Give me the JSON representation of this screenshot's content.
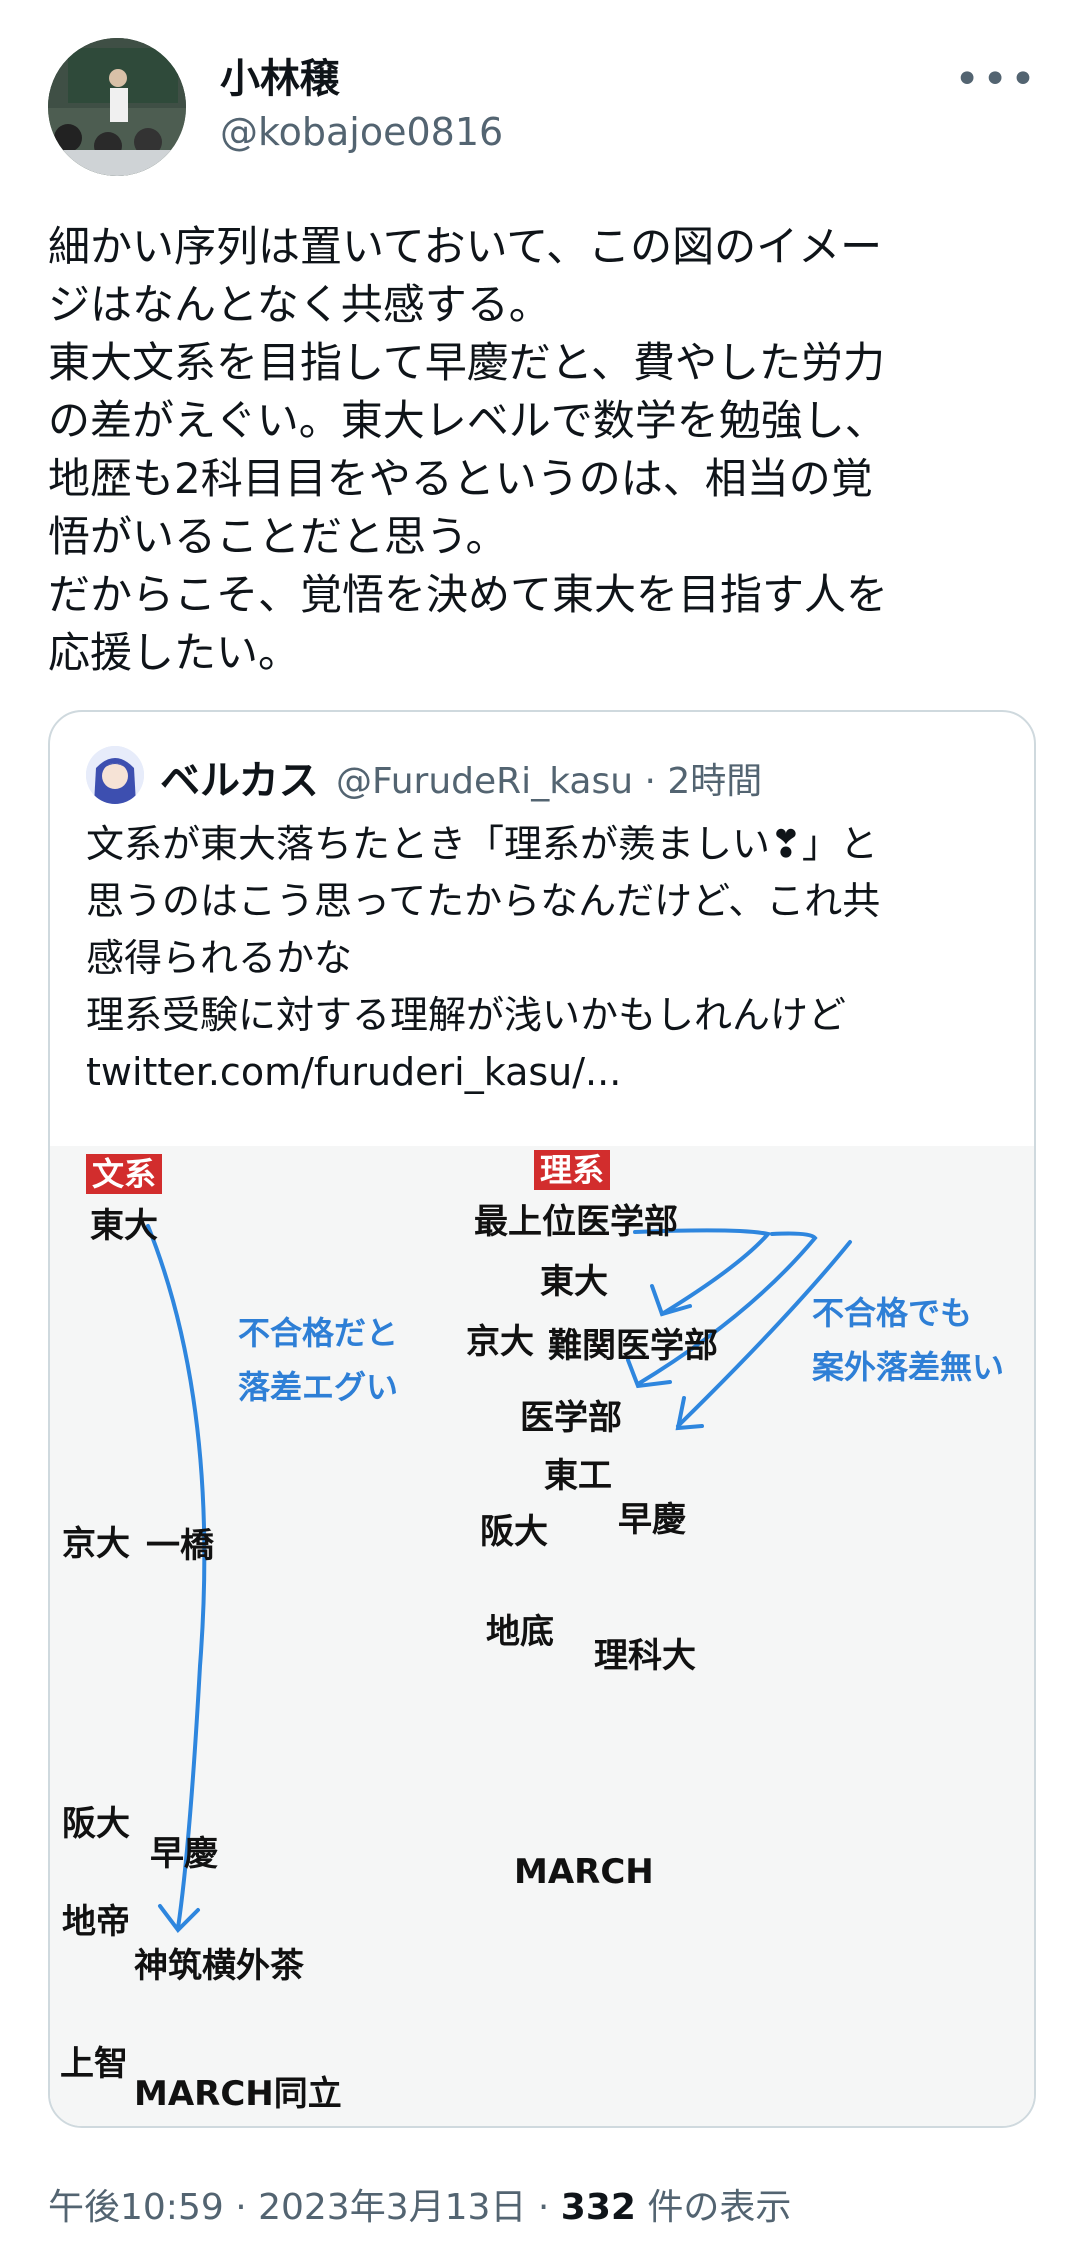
{
  "author": {
    "name": "小林穣",
    "handle": "@kobajoe0816",
    "more": "•••"
  },
  "tweet_text": "細かい序列は置いておいて、この図のイメー\nジはなんとなく共感する。\n東大文系を目指して早慶だと、費やした労力\nの差がえぐい。東大レベルで数学を勉強し、\n地歴も2科目目をやるというのは、相当の覚\n悟がいることだと思う。\nだからこそ、覚悟を決めて東大を目指す人を\n応援したい。",
  "quote": {
    "name": "ベルカス",
    "handle": "@FurudeRi_kasu",
    "time": "2時間",
    "text": "文系が東大落ちたとき「理系が羨ましい❣」と\n思うのはこう思ってたからなんだけど、これ共\n感得られるかな\n理系受験に対する理解が浅いかもしれんけど\ntwitter.com/furuderi_kasu/...",
    "image": {
      "bunkei_tag": "文系",
      "rikei_tag": "理系",
      "bunkei": {
        "todai": "東大",
        "kyodai": "京大",
        "hitotsubashi": "一橋",
        "handai": "阪大",
        "sokei": "早慶",
        "chitei": "地帝",
        "shinchiku": "神筑横外茶",
        "jochi": "上智",
        "march_doritsu": "MARCH同立"
      },
      "rikei": {
        "top_med": "最上位医学部",
        "todai": "東大",
        "kyodai": "京大",
        "nankan_med": "難関医学部",
        "med": "医学部",
        "toko": "東工",
        "handai": "阪大",
        "sokei": "早慶",
        "chitei": "地底",
        "rikadai": "理科大",
        "march": "MARCH"
      },
      "note_left": "不合格だと\n落差エグい",
      "note_right": "不合格でも\n案外落差無い"
    }
  },
  "footer": {
    "time": "午後10:59",
    "date": "2023年3月13日",
    "views_count": "332",
    "views_label": "件の表示"
  }
}
